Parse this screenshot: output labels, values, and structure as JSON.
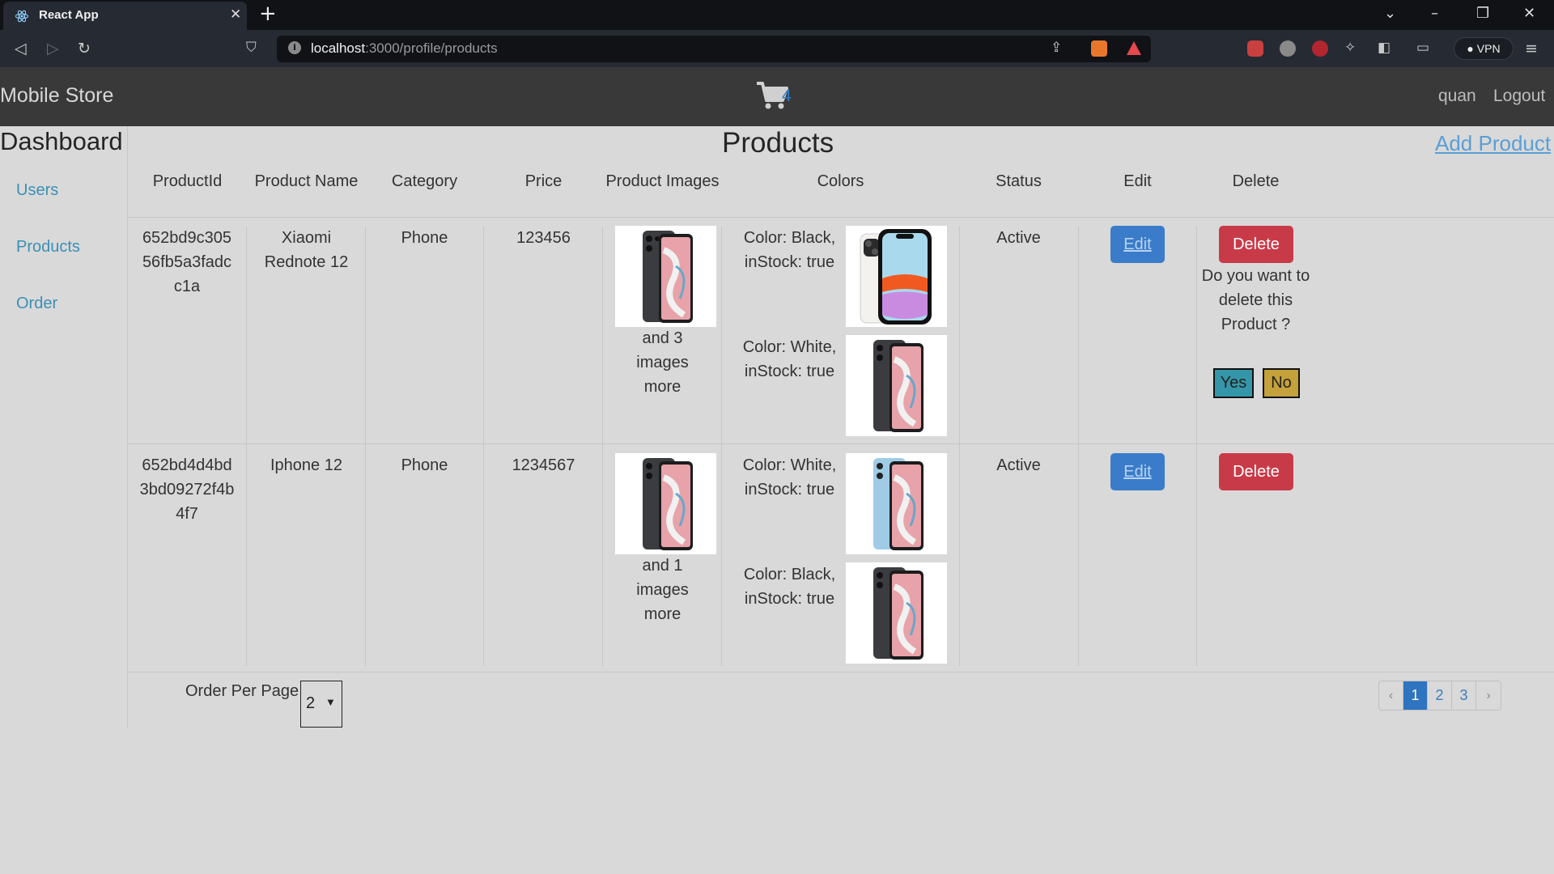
{
  "browser": {
    "tab_title": "React App",
    "url_host": "localhost",
    "url_path": ":3000/profile/products",
    "vpn_label": "VPN"
  },
  "header": {
    "brand": "Mobile Store",
    "cart_count": "4",
    "user": "quan",
    "logout": "Logout"
  },
  "sidebar": {
    "title": "Dashboard",
    "items": [
      {
        "label": "Users"
      },
      {
        "label": "Products"
      },
      {
        "label": "Order"
      }
    ]
  },
  "main": {
    "title": "Products",
    "add_link": "Add Product",
    "columns": [
      "ProductId",
      "Product Name",
      "Category",
      "Price",
      "Product Images",
      "Colors",
      "Status",
      "Edit",
      "Delete"
    ],
    "rows": [
      {
        "id": "652bd9c30556fb5a3fadcc1a",
        "name": "Xiaomi Rednote 12",
        "category": "Phone",
        "price": "123456",
        "images_more": "and 3 images more",
        "colors": [
          {
            "label": "Color: Black, inStock: true",
            "image": "iphone-white-icon"
          },
          {
            "label": "Color: White, inStock: true",
            "image": "redmi-black-icon"
          }
        ],
        "status": "Active",
        "edit": "Edit",
        "delete": "Delete"
      },
      {
        "id": "652bd4d4bd3bd09272f4b4f7",
        "name": "Iphone 12",
        "category": "Phone",
        "price": "1234567",
        "images_more": "and 1 images more",
        "colors": [
          {
            "label": "Color: White, inStock: true",
            "image": "redmi-blue-icon"
          },
          {
            "label": "Color: Black, inStock: true",
            "image": "redmi-black-icon"
          }
        ],
        "status": "Active",
        "edit": "Edit",
        "delete": "Delete"
      }
    ],
    "confirm": {
      "text": "Do you want to delete this Product ?",
      "yes": "Yes",
      "no": "No"
    },
    "per_page_label": "Order Per Page",
    "per_page_value": "2",
    "pagination": {
      "prev": "‹",
      "pages": [
        "1",
        "2",
        "3"
      ],
      "active": "1",
      "next": "›"
    }
  }
}
